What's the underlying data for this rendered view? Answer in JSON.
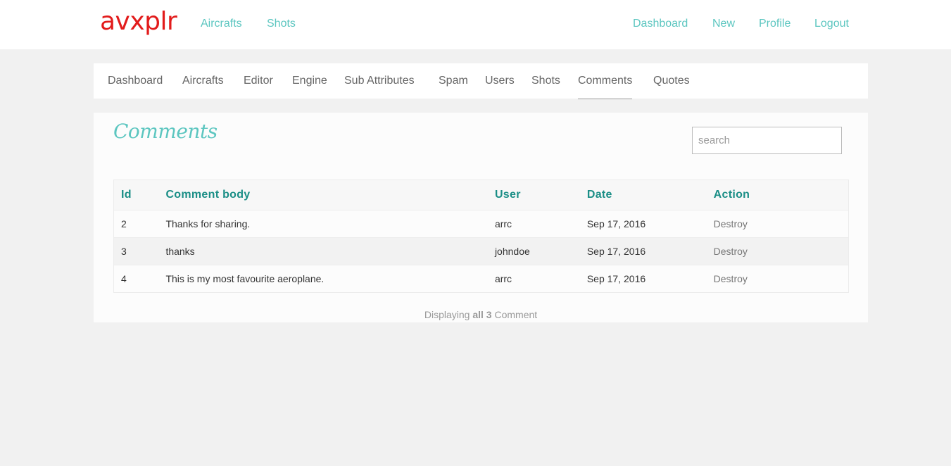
{
  "brand": "avxplr",
  "top_nav": {
    "left": [
      {
        "label": "Aircrafts"
      },
      {
        "label": "Shots"
      }
    ],
    "right": [
      {
        "label": "Dashboard"
      },
      {
        "label": "New"
      },
      {
        "label": "Profile"
      },
      {
        "label": "Logout"
      }
    ]
  },
  "sub_nav": {
    "items": [
      {
        "label": "Dashboard"
      },
      {
        "label": "Aircrafts"
      },
      {
        "label": "Editor"
      },
      {
        "label": "Engine"
      },
      {
        "label": "Sub Attributes"
      },
      {
        "label": "Spam"
      },
      {
        "label": "Users"
      },
      {
        "label": "Shots"
      },
      {
        "label": "Comments"
      },
      {
        "label": "Quotes"
      }
    ],
    "active": "Comments"
  },
  "page": {
    "title": "Comments",
    "search_placeholder": "search"
  },
  "table": {
    "columns": [
      "Id",
      "Comment body",
      "User",
      "Date",
      "Action"
    ],
    "rows": [
      [
        "2",
        "Thanks for sharing.",
        "arrc",
        "Sep 17, 2016",
        "Destroy"
      ],
      [
        "3",
        "thanks",
        "johndoe",
        "Sep 17, 2016",
        "Destroy"
      ],
      [
        "4",
        "This is my most favourite aeroplane.",
        "arrc",
        "Sep 17, 2016",
        "Destroy"
      ]
    ]
  },
  "pagination": {
    "prefix": "Displaying",
    "bold": "all 3",
    "suffix": "Comment"
  },
  "colors": {
    "brand": "#e21b1b",
    "accent": "#5cc6c0",
    "header_text": "#1a8e86"
  }
}
